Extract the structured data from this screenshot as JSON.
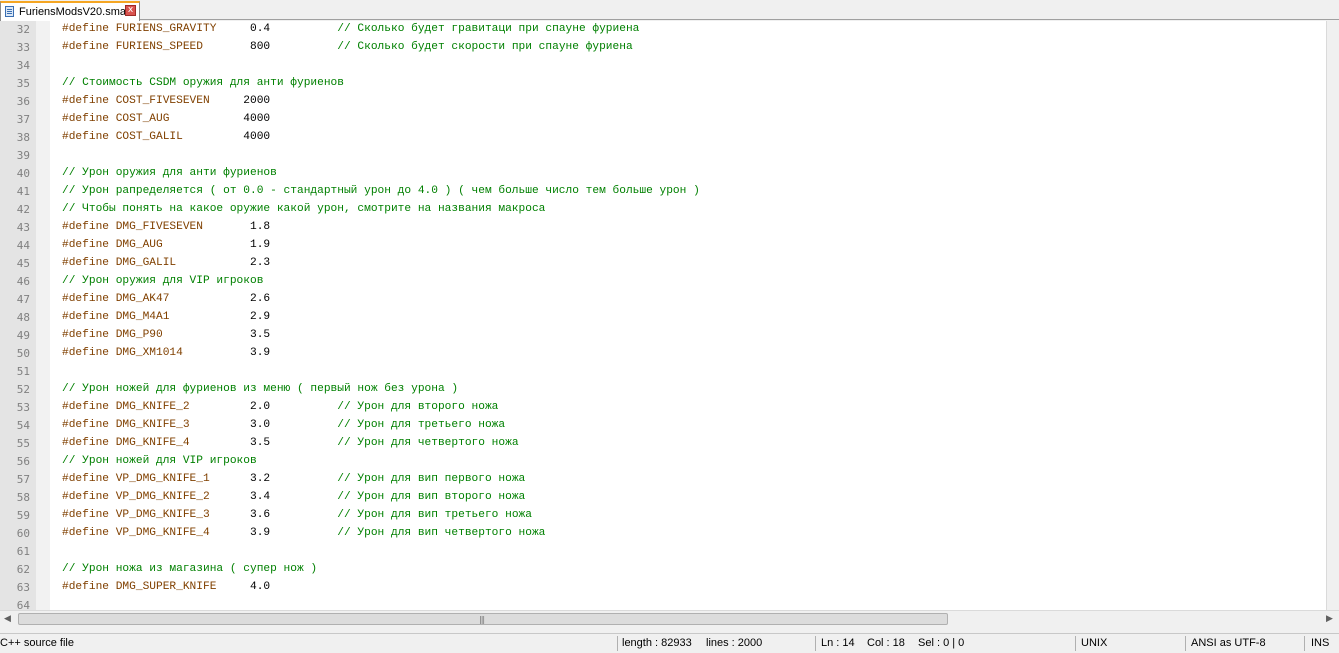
{
  "tab": {
    "label": "FuriensModsV20.sma",
    "close_label": "x"
  },
  "editor": {
    "lines": [
      {
        "n": "32",
        "parts": [
          [
            "kw",
            "#define FURIENS_GRAVITY     "
          ],
          [
            "num",
            "0.4          "
          ],
          [
            "cm",
            "// Сколько будет гравитаци при спауне фуриена"
          ]
        ]
      },
      {
        "n": "33",
        "parts": [
          [
            "kw",
            "#define FURIENS_SPEED       "
          ],
          [
            "num",
            "800          "
          ],
          [
            "cm",
            "// Сколько будет скорости при спауне фуриена"
          ]
        ]
      },
      {
        "n": "34",
        "parts": []
      },
      {
        "n": "35",
        "parts": [
          [
            "cm",
            "// Стоимость CSDM оружия для анти фуриенов"
          ]
        ]
      },
      {
        "n": "36",
        "parts": [
          [
            "kw",
            "#define COST_FIVESEVEN     "
          ],
          [
            "num",
            "2000"
          ]
        ]
      },
      {
        "n": "37",
        "parts": [
          [
            "kw",
            "#define COST_AUG           "
          ],
          [
            "num",
            "4000"
          ]
        ]
      },
      {
        "n": "38",
        "parts": [
          [
            "kw",
            "#define COST_GALIL         "
          ],
          [
            "num",
            "4000"
          ]
        ]
      },
      {
        "n": "39",
        "parts": []
      },
      {
        "n": "40",
        "parts": [
          [
            "cm",
            "// Урон оружия для анти фуриенов"
          ]
        ]
      },
      {
        "n": "41",
        "parts": [
          [
            "cm",
            "// Урон рапределяется ( от 0.0 - стандартный урон до 4.0 ) ( чем больше число тем больше урон )"
          ]
        ]
      },
      {
        "n": "42",
        "parts": [
          [
            "cm",
            "// Чтобы понять на какое оружие какой урон, смотрите на названия макроса"
          ]
        ]
      },
      {
        "n": "43",
        "parts": [
          [
            "kw",
            "#define DMG_FIVESEVEN       "
          ],
          [
            "num",
            "1.8"
          ]
        ]
      },
      {
        "n": "44",
        "parts": [
          [
            "kw",
            "#define DMG_AUG             "
          ],
          [
            "num",
            "1.9"
          ]
        ]
      },
      {
        "n": "45",
        "parts": [
          [
            "kw",
            "#define DMG_GALIL           "
          ],
          [
            "num",
            "2.3"
          ]
        ]
      },
      {
        "n": "46",
        "parts": [
          [
            "cm",
            "// Урон оружия для VIP игроков"
          ]
        ]
      },
      {
        "n": "47",
        "parts": [
          [
            "kw",
            "#define DMG_AK47            "
          ],
          [
            "num",
            "2.6"
          ]
        ]
      },
      {
        "n": "48",
        "parts": [
          [
            "kw",
            "#define DMG_M4A1            "
          ],
          [
            "num",
            "2.9"
          ]
        ]
      },
      {
        "n": "49",
        "parts": [
          [
            "kw",
            "#define DMG_P90             "
          ],
          [
            "num",
            "3.5"
          ]
        ]
      },
      {
        "n": "50",
        "parts": [
          [
            "kw",
            "#define DMG_XM1014          "
          ],
          [
            "num",
            "3.9"
          ]
        ]
      },
      {
        "n": "51",
        "parts": []
      },
      {
        "n": "52",
        "parts": [
          [
            "cm",
            "// Урон ножей для фуриенов из меню ( первый нож без урона )"
          ]
        ]
      },
      {
        "n": "53",
        "parts": [
          [
            "kw",
            "#define DMG_KNIFE_2         "
          ],
          [
            "num",
            "2.0          "
          ],
          [
            "cm",
            "// Урон для второго ножа"
          ]
        ]
      },
      {
        "n": "54",
        "parts": [
          [
            "kw",
            "#define DMG_KNIFE_3         "
          ],
          [
            "num",
            "3.0          "
          ],
          [
            "cm",
            "// Урон для третьего ножа"
          ]
        ]
      },
      {
        "n": "55",
        "parts": [
          [
            "kw",
            "#define DMG_KNIFE_4         "
          ],
          [
            "num",
            "3.5          "
          ],
          [
            "cm",
            "// Урон для четвертого ножа"
          ]
        ]
      },
      {
        "n": "56",
        "parts": [
          [
            "cm",
            "// Урон ножей для VIP игроков"
          ]
        ]
      },
      {
        "n": "57",
        "parts": [
          [
            "kw",
            "#define VP_DMG_KNIFE_1      "
          ],
          [
            "num",
            "3.2          "
          ],
          [
            "cm",
            "// Урон для вип первого ножа"
          ]
        ]
      },
      {
        "n": "58",
        "parts": [
          [
            "kw",
            "#define VP_DMG_KNIFE_2      "
          ],
          [
            "num",
            "3.4          "
          ],
          [
            "cm",
            "// Урон для вип второго ножа"
          ]
        ]
      },
      {
        "n": "59",
        "parts": [
          [
            "kw",
            "#define VP_DMG_KNIFE_3      "
          ],
          [
            "num",
            "3.6          "
          ],
          [
            "cm",
            "// Урон для вип третьего ножа"
          ]
        ]
      },
      {
        "n": "60",
        "parts": [
          [
            "kw",
            "#define VP_DMG_KNIFE_4      "
          ],
          [
            "num",
            "3.9          "
          ],
          [
            "cm",
            "// Урон для вип четвертого ножа"
          ]
        ]
      },
      {
        "n": "61",
        "parts": []
      },
      {
        "n": "62",
        "parts": [
          [
            "cm",
            "// Урон ножа из магазина ( супер нож )"
          ]
        ]
      },
      {
        "n": "63",
        "parts": [
          [
            "kw",
            "#define DMG_SUPER_KNIFE     "
          ],
          [
            "num",
            "4.0"
          ]
        ]
      },
      {
        "n": "64",
        "parts": []
      }
    ],
    "colors": {
      "keyword": "#804000",
      "number": "#000000",
      "comment": "#008000"
    }
  },
  "hscroll": {
    "left_arrow": "◀",
    "right_arrow": "▶",
    "grip": "|||"
  },
  "status": {
    "file_type": "C++ source file",
    "length": "length : 82933",
    "lines": "lines : 2000",
    "ln": "Ln : 14",
    "col": "Col : 18",
    "sel": "Sel : 0 | 0",
    "eol": "UNIX",
    "encoding": "ANSI as UTF-8",
    "mode": "INS"
  }
}
